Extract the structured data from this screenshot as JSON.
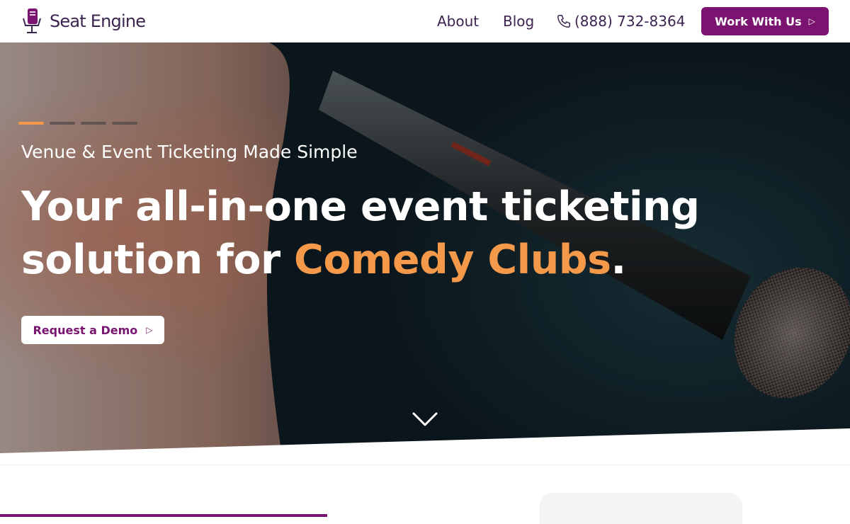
{
  "header": {
    "logo_text": "Seat Engine",
    "nav": {
      "about": "About",
      "blog": "Blog",
      "phone": "(888) 732-8364"
    },
    "cta_label": "Work With Us"
  },
  "hero": {
    "slides_total": 4,
    "active_slide": 1,
    "eyebrow": "Venue & Event Ticketing Made Simple",
    "headline_part1": "Your all-in-one event ticketing solution for ",
    "headline_accent": "Comedy Clubs",
    "headline_end": ".",
    "demo_label": "Request a Demo"
  },
  "icons": {
    "logo": "seat-chair-icon",
    "phone": "phone-icon",
    "button_arrow": "arrow-right-icon",
    "scroll": "chevron-down-icon"
  },
  "colors": {
    "brand_purple": "#7a1470",
    "accent_orange": "#f4994a",
    "text_dark": "#3d2450"
  }
}
